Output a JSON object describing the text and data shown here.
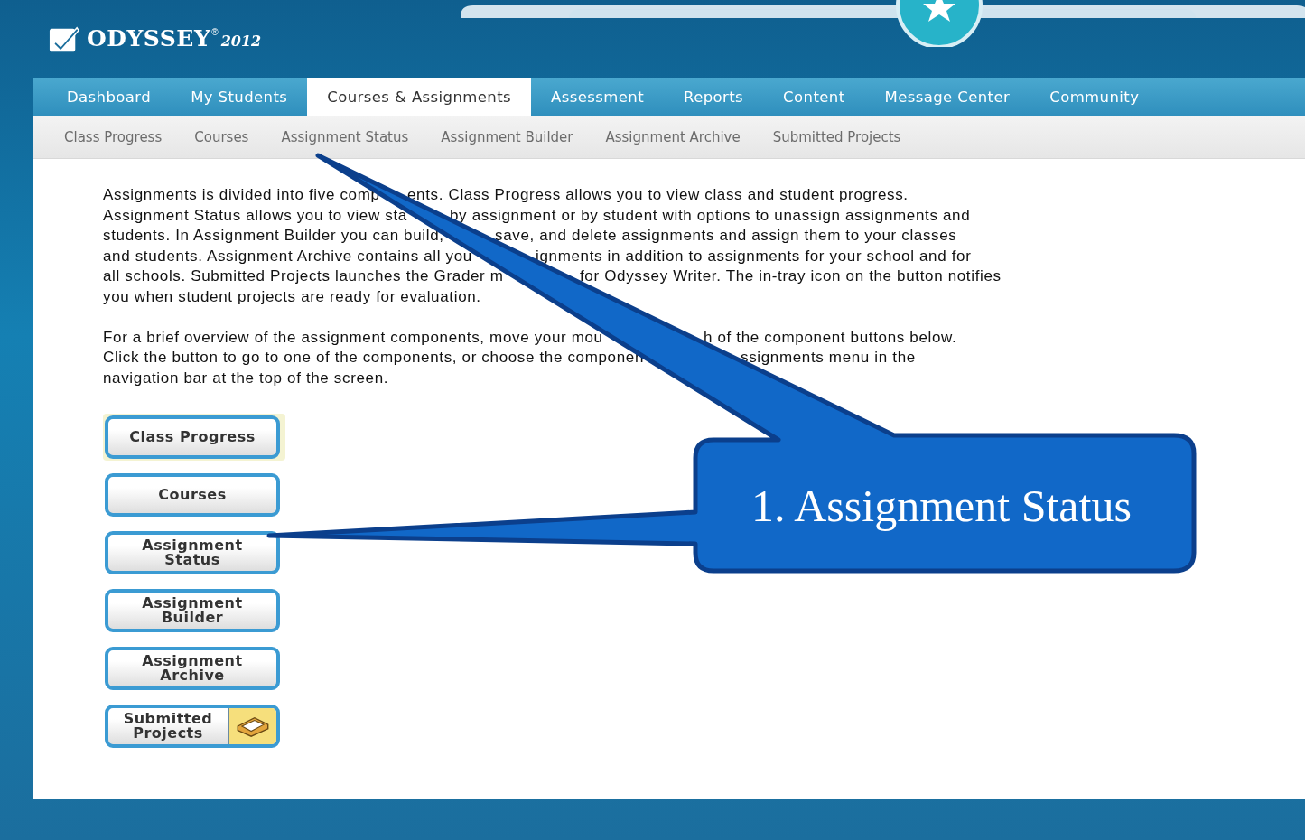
{
  "logo": {
    "name": "ODYSSEY",
    "mark": "®",
    "year": "2012"
  },
  "tabs": [
    {
      "label": "Dashboard",
      "selected": false
    },
    {
      "label": "My Students",
      "selected": false
    },
    {
      "label": "Courses & Assignments",
      "selected": true
    },
    {
      "label": "Assessment",
      "selected": false
    },
    {
      "label": "Reports",
      "selected": false
    },
    {
      "label": "Content",
      "selected": false
    },
    {
      "label": "Message Center",
      "selected": false
    },
    {
      "label": "Community",
      "selected": false
    }
  ],
  "subnav": [
    "Class Progress",
    "Courses",
    "Assignment Status",
    "Assignment Builder",
    "Assignment Archive",
    "Submitted Projects"
  ],
  "paragraphs": [
    {
      "lines": [
        [
          "Assignments is divided into five comp",
          "ents. Class Progress allows you to view class and student progress."
        ],
        [
          "Assignment Status allows you to view sta",
          "by assignment or by student with options to unassign assignments and"
        ],
        [
          "students. In Assignment Builder you can build,",
          "save, and delete assignments and assign them to your classes"
        ],
        [
          "and students. Assignment Archive contains all you",
          "ignments in addition to assignments for your school and for"
        ],
        [
          "all schools. Submitted Projects launches the Grader m",
          "for Odyssey Writer. The in-tray icon on the button notifies"
        ],
        [
          "you when student projects are ready for evaluation."
        ]
      ]
    },
    {
      "lines": [
        [
          "For a brief overview of the assignment components, move your mou",
          "h of the component buttons below."
        ],
        [
          "Click the button to go to one of the components, or choose the componen",
          "ssignments menu in the"
        ],
        [
          "navigation bar at the top of the screen."
        ]
      ]
    }
  ],
  "component_buttons": [
    {
      "kind": "plain",
      "label": "Class Progress",
      "highlighted": true
    },
    {
      "kind": "plain",
      "label": "Courses",
      "highlighted": false
    },
    {
      "kind": "plain",
      "label": "Assignment Status",
      "highlighted": false
    },
    {
      "kind": "plain",
      "label": "Assignment Builder",
      "highlighted": false
    },
    {
      "kind": "plain",
      "label": "Assignment Archive",
      "highlighted": false
    },
    {
      "kind": "tray",
      "label": "Submitted Projects",
      "highlighted": false
    }
  ],
  "callout": {
    "text": "1. Assignment Status"
  }
}
